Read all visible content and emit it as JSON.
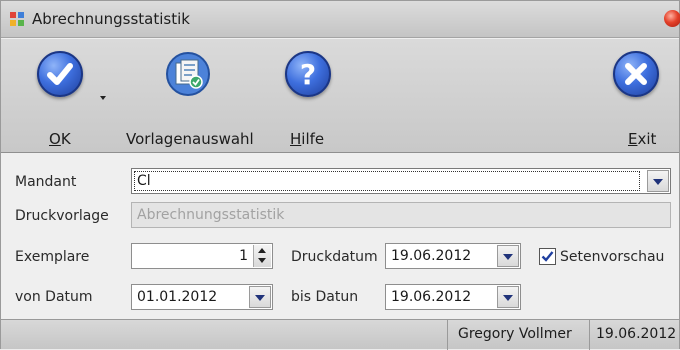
{
  "window": {
    "title": "Abrechnungsstatistik",
    "icon": "app-grid-icon",
    "close_icon": "close-dot-icon"
  },
  "toolbar": {
    "ok": {
      "label_underline": "O",
      "label_rest": "K",
      "icon": "checkmark-icon",
      "has_dropdown": true
    },
    "templates": {
      "label": "Vorlagenauswahl",
      "icon": "template-select-icon"
    },
    "help": {
      "label_underline": "H",
      "label_rest": "ilfe",
      "icon": "question-icon"
    },
    "exit": {
      "label_underline": "E",
      "label_rest": "xit",
      "icon": "exit-x-icon"
    }
  },
  "form": {
    "mandant": {
      "label": "Mandant",
      "value": "Cl"
    },
    "druckvorlage": {
      "label": "Druckvorlage",
      "value": "Abrechnungsstatistik"
    },
    "exemplare": {
      "label": "Exemplare",
      "value": "1"
    },
    "druckdatum": {
      "label": "Druckdatum",
      "value": "19.06.2012"
    },
    "seitenvorschau": {
      "label": "Setenvorschau",
      "checked": true
    },
    "von_datum": {
      "label": "von Datum",
      "value": "01.01.2012"
    },
    "bis_datum": {
      "label": "bis Datun",
      "value": "19.06.2012"
    }
  },
  "status": {
    "user": "Gregory Vollmer",
    "date": "19.06.2012"
  },
  "colors": {
    "accent_blue": "#3e6fde",
    "close_red": "#e4412a",
    "check_blue": "#1f3fa0"
  }
}
